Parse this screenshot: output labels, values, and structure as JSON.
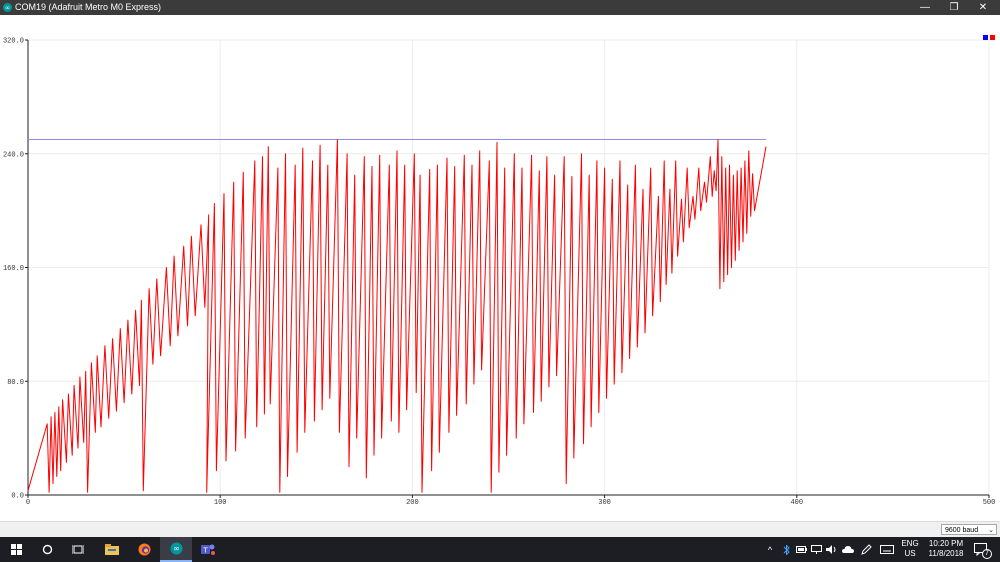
{
  "window": {
    "title": "COM19 (Adafruit Metro M0 Express)",
    "minimize": "—",
    "restore": "❐",
    "close": "✕"
  },
  "legend": {
    "series1_color": "#0000ff",
    "series2_color": "#ff0000"
  },
  "chart_data": {
    "type": "line",
    "xlim": [
      0,
      500
    ],
    "ylim": [
      0,
      320
    ],
    "x_ticks": [
      "0",
      "100",
      "200",
      "300",
      "400",
      "500"
    ],
    "y_ticks": [
      "0.0",
      "80.0",
      "160.0",
      "240.0",
      "320.0"
    ],
    "grid": true,
    "series": [
      {
        "color": "#8a8ff0",
        "points": [
          [
            0,
            250
          ],
          [
            384,
            250
          ]
        ]
      },
      {
        "color": "#ff0000",
        "points": [
          [
            0,
            3
          ],
          [
            10,
            50
          ],
          [
            11,
            2
          ],
          [
            12,
            55
          ],
          [
            13,
            8
          ],
          [
            14,
            58
          ],
          [
            15,
            13
          ],
          [
            16,
            62
          ],
          [
            17,
            17
          ],
          [
            18,
            67
          ],
          [
            20,
            23
          ],
          [
            21,
            71
          ],
          [
            23,
            28
          ],
          [
            24,
            77
          ],
          [
            26,
            33
          ],
          [
            27,
            83
          ],
          [
            29,
            37
          ],
          [
            30,
            87
          ],
          [
            31,
            2
          ],
          [
            33,
            93
          ],
          [
            35,
            44
          ],
          [
            36,
            98
          ],
          [
            38,
            48
          ],
          [
            40,
            105
          ],
          [
            42,
            54
          ],
          [
            44,
            110
          ],
          [
            46,
            59
          ],
          [
            48,
            117
          ],
          [
            50,
            65
          ],
          [
            52,
            123
          ],
          [
            54,
            71
          ],
          [
            56,
            130
          ],
          [
            58,
            77
          ],
          [
            59,
            137
          ],
          [
            60,
            3
          ],
          [
            63,
            145
          ],
          [
            65,
            92
          ],
          [
            67,
            152
          ],
          [
            69,
            98
          ],
          [
            72,
            160
          ],
          [
            74,
            105
          ],
          [
            76,
            168
          ],
          [
            78,
            112
          ],
          [
            81,
            175
          ],
          [
            83,
            119
          ],
          [
            85,
            182
          ],
          [
            87,
            126
          ],
          [
            90,
            190
          ],
          [
            92,
            132
          ],
          [
            94,
            197
          ],
          [
            93,
            2
          ],
          [
            97,
            205
          ],
          [
            98,
            17
          ],
          [
            102,
            212
          ],
          [
            103,
            24
          ],
          [
            107,
            220
          ],
          [
            108,
            31
          ],
          [
            112,
            227
          ],
          [
            113,
            40
          ],
          [
            118,
            235
          ],
          [
            119,
            48
          ],
          [
            122,
            238
          ],
          [
            123,
            57
          ],
          [
            125,
            245
          ],
          [
            126,
            64
          ],
          [
            130,
            230
          ],
          [
            131,
            2
          ],
          [
            134,
            240
          ],
          [
            135,
            13
          ],
          [
            139,
            232
          ],
          [
            140,
            30
          ],
          [
            143,
            244
          ],
          [
            144,
            44
          ],
          [
            148,
            235
          ],
          [
            149,
            52
          ],
          [
            152,
            246
          ],
          [
            153,
            60
          ],
          [
            156,
            232
          ],
          [
            157,
            68
          ],
          [
            161,
            250
          ],
          [
            162,
            44
          ],
          [
            166,
            240
          ],
          [
            167,
            20
          ],
          [
            170,
            225
          ],
          [
            171,
            40
          ],
          [
            175,
            238
          ],
          [
            176,
            12
          ],
          [
            179,
            231
          ],
          [
            180,
            28
          ],
          [
            183,
            239
          ],
          [
            184,
            40
          ],
          [
            188,
            232
          ],
          [
            189,
            52
          ],
          [
            192,
            242
          ],
          [
            193,
            44
          ],
          [
            196,
            232
          ],
          [
            197,
            60
          ],
          [
            201,
            240
          ],
          [
            202,
            72
          ],
          [
            204,
            225
          ],
          [
            205,
            2
          ],
          [
            209,
            229
          ],
          [
            210,
            17
          ],
          [
            213,
            232
          ],
          [
            214,
            30
          ],
          [
            218,
            237
          ],
          [
            219,
            44
          ],
          [
            222,
            231
          ],
          [
            223,
            56
          ],
          [
            227,
            239
          ],
          [
            228,
            64
          ],
          [
            231,
            232
          ],
          [
            232,
            78
          ],
          [
            235,
            242
          ],
          [
            236,
            88
          ],
          [
            240,
            235
          ],
          [
            241,
            2
          ],
          [
            244,
            248
          ],
          [
            245,
            16
          ],
          [
            248,
            230
          ],
          [
            249,
            28
          ],
          [
            253,
            240
          ],
          [
            254,
            40
          ],
          [
            257,
            230
          ],
          [
            258,
            50
          ],
          [
            262,
            239
          ],
          [
            263,
            58
          ],
          [
            266,
            228
          ],
          [
            267,
            66
          ],
          [
            270,
            238
          ],
          [
            271,
            76
          ],
          [
            274,
            225
          ],
          [
            275,
            84
          ],
          [
            279,
            238
          ],
          [
            280,
            8
          ],
          [
            283,
            224
          ],
          [
            284,
            26
          ],
          [
            288,
            240
          ],
          [
            289,
            36
          ],
          [
            292,
            225
          ],
          [
            293,
            48
          ],
          [
            296,
            235
          ],
          [
            297,
            58
          ],
          [
            300,
            230
          ],
          [
            301,
            68
          ],
          [
            304,
            222
          ],
          [
            305,
            78
          ],
          [
            308,
            235
          ],
          [
            309,
            86
          ],
          [
            312,
            218
          ],
          [
            313,
            96
          ],
          [
            316,
            232
          ],
          [
            317,
            104
          ],
          [
            320,
            215
          ],
          [
            321,
            114
          ],
          [
            324,
            230
          ],
          [
            325,
            126
          ],
          [
            328,
            210
          ],
          [
            329,
            136
          ],
          [
            331,
            235
          ],
          [
            332,
            148
          ],
          [
            334,
            215
          ],
          [
            335,
            156
          ],
          [
            337,
            235
          ],
          [
            338,
            168
          ],
          [
            340,
            208
          ],
          [
            341,
            178
          ],
          [
            343,
            230
          ],
          [
            344,
            188
          ],
          [
            346,
            210
          ],
          [
            347,
            194
          ],
          [
            349,
            230
          ],
          [
            350,
            200
          ],
          [
            352,
            220
          ],
          [
            353,
            206
          ],
          [
            355,
            238
          ],
          [
            356,
            210
          ],
          [
            357,
            228
          ],
          [
            358,
            214
          ],
          [
            359,
            250
          ],
          [
            360,
            145
          ],
          [
            361,
            238
          ],
          [
            362,
            150
          ],
          [
            363,
            230
          ],
          [
            364,
            155
          ],
          [
            365,
            232
          ],
          [
            366,
            160
          ],
          [
            367,
            225
          ],
          [
            368,
            165
          ],
          [
            369,
            228
          ],
          [
            370,
            172
          ],
          [
            371,
            230
          ],
          [
            372,
            178
          ],
          [
            373,
            235
          ],
          [
            374,
            184
          ],
          [
            375,
            242
          ],
          [
            376,
            196
          ],
          [
            377,
            226
          ],
          [
            378,
            200
          ],
          [
            384,
            245
          ]
        ]
      }
    ]
  },
  "statusbar": {
    "baud": "9600 baud",
    "baud_arrow": "⌄"
  },
  "taskbar": {
    "items": [
      {
        "name": "windows-start-icon",
        "glyph": "⊞"
      },
      {
        "name": "search-icon",
        "glyph": "○"
      },
      {
        "name": "task-view-icon",
        "glyph": "⧉"
      },
      {
        "name": "file-explorer-icon",
        "glyph": "▬"
      },
      {
        "name": "firefox-icon",
        "glyph": "●"
      },
      {
        "name": "arduino-icon",
        "glyph": "∞"
      },
      {
        "name": "teams-icon",
        "glyph": "T"
      }
    ],
    "tray": {
      "chevron": "^",
      "lang": "ENG",
      "region": "US",
      "time": "10:20 PM",
      "date": "11/8/2018",
      "notifications": "7"
    }
  }
}
